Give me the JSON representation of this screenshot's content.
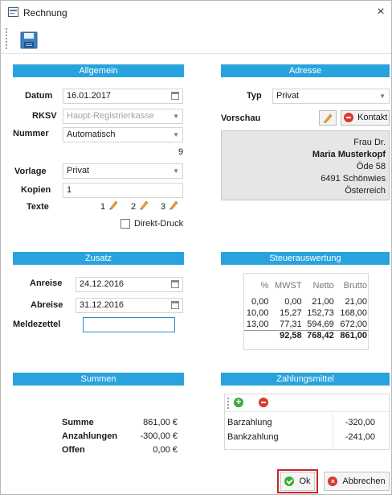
{
  "window": {
    "title": "Rechnung",
    "close": "×"
  },
  "sections": {
    "allgemein": "Allgemein",
    "adresse": "Adresse",
    "zusatz": "Zusatz",
    "steuer": "Steuerauswertung",
    "summen": "Summen",
    "zahlungsmittel": "Zahlungsmittel"
  },
  "allgemein": {
    "datum_label": "Datum",
    "datum_value": "16.01.2017",
    "rksv_label": "RKSV",
    "rksv_value": "Haupt-Registrierkasse",
    "nummer_label": "Nummer",
    "nummer_value": "Automatisch",
    "nummer_extra": "9",
    "vorlage_label": "Vorlage",
    "vorlage_value": "Privat",
    "kopien_label": "Kopien",
    "kopien_value": "1",
    "texte_label": "Texte",
    "texte_1": "1",
    "texte_2": "2",
    "texte_3": "3",
    "direkt_druck": "Direkt-Druck"
  },
  "adresse": {
    "typ_label": "Typ",
    "typ_value": "Privat",
    "vorschau_label": "Vorschau",
    "kontakt_button": "Kontakt",
    "lines": [
      "Frau Dr.",
      "Maria Musterkopf",
      "Öde 58",
      "6491 Schönwies",
      "Österreich"
    ]
  },
  "zusatz": {
    "anreise_label": "Anreise",
    "anreise_value": "24.12.2016",
    "abreise_label": "Abreise",
    "abreise_value": "31.12.2016",
    "meldezettel_label": "Meldezettel",
    "meldezettel_value": ""
  },
  "steuer": {
    "headers": [
      "%",
      "MWST",
      "Netto",
      "Brutto"
    ],
    "rows": [
      [
        "0,00",
        "0,00",
        "21,00",
        "21,00"
      ],
      [
        "10,00",
        "15,27",
        "152,73",
        "168,00"
      ],
      [
        "13,00",
        "77,31",
        "594,69",
        "672,00"
      ]
    ],
    "totals": [
      "",
      "92,58",
      "768,42",
      "861,00"
    ]
  },
  "summen": {
    "summe_label": "Summe",
    "summe_value": "861,00 €",
    "anzahlungen_label": "Anzahlungen",
    "anzahlungen_value": "-300,00 €",
    "offen_label": "Offen",
    "offen_value": "0,00 €"
  },
  "zahlungsmittel": {
    "items": [
      {
        "name": "Barzahlung",
        "amount": "-320,00"
      },
      {
        "name": "Bankzahlung",
        "amount": "-241,00"
      }
    ]
  },
  "footer": {
    "ok": "Ok",
    "cancel": "Abbrechen"
  },
  "colors": {
    "header": "#29a3dd",
    "highlight_border": "#c1272d"
  }
}
